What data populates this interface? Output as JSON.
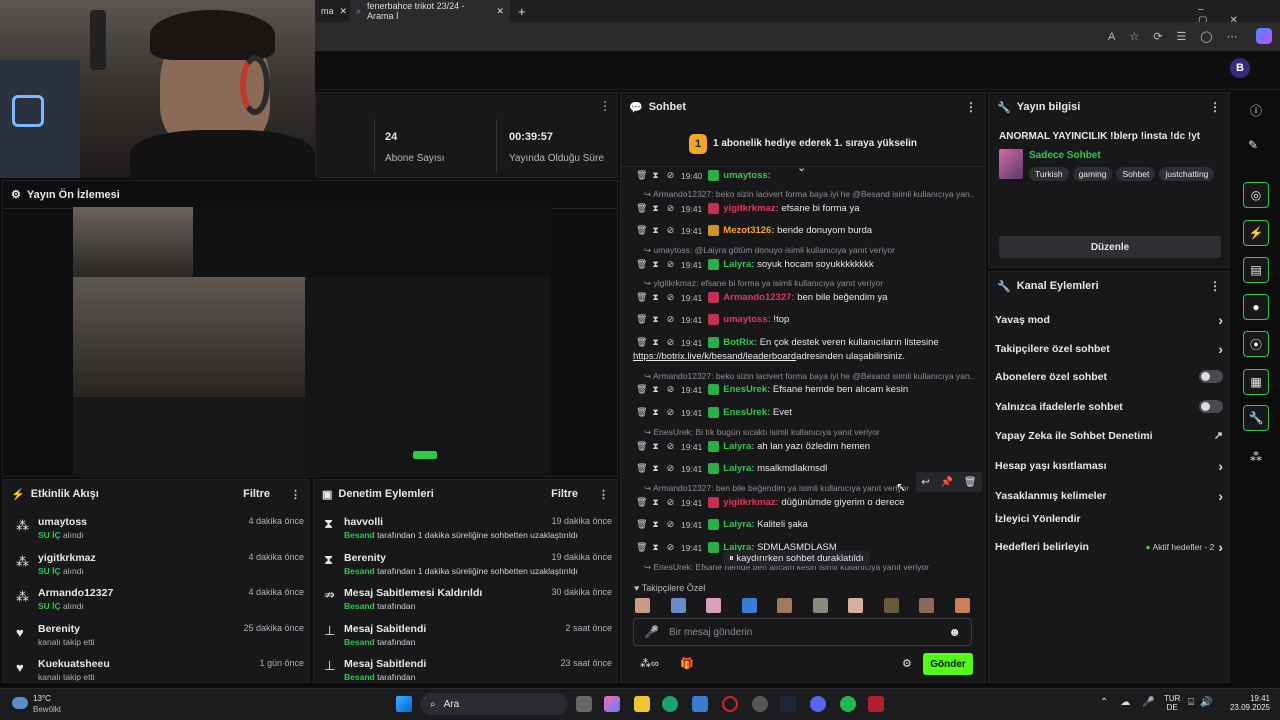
{
  "browser": {
    "tab1_label": "ma",
    "tab2_label": "fenerbahce trikot 23/24 - Arama İ",
    "new_tab": "+"
  },
  "stats": [
    {
      "value": "24",
      "label": "Abone Sayısı"
    },
    {
      "value": "00:39:57",
      "label": "Yayında Olduğu Süre"
    }
  ],
  "preview": {
    "title": "Yayın Ön İzlemesi"
  },
  "activity": {
    "title": "Etkinlik Akışı",
    "filter": "Filtre",
    "items": [
      {
        "user": "umaytoss",
        "action": "SU İÇ",
        "suffix": " alındı",
        "time": "4 dakika önce"
      },
      {
        "user": "yigitkrkmaz",
        "action": "SU İÇ",
        "suffix": " alındı",
        "time": "4 dakika önce"
      },
      {
        "user": "Armando12327",
        "action": "SU İÇ",
        "suffix": " alındı",
        "time": "4 dakika önce"
      },
      {
        "user": "Berenity",
        "action": "",
        "suffix": "kanalı takip etti",
        "time": "25 dakika önce"
      },
      {
        "user": "Kuekuatsheeu",
        "action": "",
        "suffix": "kanalı takip etti",
        "time": "1 gün önce"
      }
    ]
  },
  "moderation": {
    "title": "Denetim Eylemleri",
    "filter": "Filtre",
    "items": [
      {
        "title": "havvolli",
        "by": "Besand",
        "detail": " tarafından 1 dakika süreliğine sohbetten uzaklaştırıldı",
        "time": "19 dakika önce"
      },
      {
        "title": "Berenity",
        "by": "Besand",
        "detail": " tarafından 1 dakika süreliğine sohbetten uzaklaştırıldı",
        "time": "19 dakika önce"
      },
      {
        "title": "Mesaj Sabitlemesi Kaldırıldı",
        "by": "Besand",
        "detail": " tarafından",
        "time": "30 dakika önce"
      },
      {
        "title": "Mesaj Sabitlendi",
        "by": "Besand",
        "detail": " tarafından",
        "time": "2 saat önce"
      },
      {
        "title": "Mesaj Sabitlendi",
        "by": "Besand",
        "detail": " tarafından",
        "time": "23 saat önce"
      }
    ]
  },
  "chat": {
    "title": "Sohbet",
    "goal_badge": "1",
    "goal_text": "1 abonelik hediye ederek 1. sıraya yükselin",
    "messages": [
      {
        "kind": "msg",
        "time": "19:40",
        "user": "umaytoss:",
        "color": "#2fc94c",
        "text": ""
      },
      {
        "kind": "reply",
        "text": "Armando12327: beko sizin lacivert forma baya iyi he @Besand isimli kullanıcıya yan..."
      },
      {
        "kind": "msg",
        "time": "19:41",
        "user": "yigitkrkmaz:",
        "color": "#e0365a",
        "text": " efsane bi forma ya"
      },
      {
        "kind": "msg",
        "time": "19:41",
        "user": "Mezot3126:",
        "color": "#f5a623",
        "text": " bende donuyom burda"
      },
      {
        "kind": "reply",
        "text": "umaytoss: @Laiyra götüm donuyo isimli kullanıcıya yanıt veriyor"
      },
      {
        "kind": "msg",
        "time": "19:41",
        "user": "Laiyra:",
        "color": "#2fc94c",
        "text": " soyuk hocam soyukkkkkkkk"
      },
      {
        "kind": "reply",
        "text": "yigitkrkmaz: efsane bi forma ya isimli kullanıcıya yanıt veriyor"
      },
      {
        "kind": "msg",
        "time": "19:41",
        "user": "Armando12327:",
        "color": "#e0365a",
        "text": " ben bile beğendim ya"
      },
      {
        "kind": "msg",
        "time": "19:41",
        "user": "umaytoss:",
        "color": "#e0365a",
        "text": " !top"
      },
      {
        "kind": "msg",
        "time": "19:41",
        "user": "BotRix:",
        "color": "#2fc94c",
        "text": " En çok destek veren kullanıcıların listesine"
      },
      {
        "kind": "cont",
        "link": "https://botrix.live/k/besand/leaderboard",
        "text": " adresinden ulaşabilirsiniz."
      },
      {
        "kind": "reply",
        "text": "Armando12327: beko sizin lacivert forma baya iyi he @Besand isimli kullanıcıya yan..."
      },
      {
        "kind": "msg",
        "time": "19:41",
        "user": "EnesUrek:",
        "color": "#2fc94c",
        "text": " Efsane hemde ben alıcam kesin"
      },
      {
        "kind": "msg",
        "time": "19:41",
        "user": "EnesUrek:",
        "color": "#2fc94c",
        "text": " Evet"
      },
      {
        "kind": "reply",
        "text": "EnesUrek: Bi tık bugün sıcaktı isimli kullanıcıya yanıt veriyor"
      },
      {
        "kind": "msg",
        "time": "19:41",
        "user": "Laiyra:",
        "color": "#2fc94c",
        "text": " ah lan yazı özledim hemen"
      },
      {
        "kind": "msg",
        "time": "19:41",
        "user": "Laiyra:",
        "color": "#2fc94c",
        "text": " msalkmdlakmsdl"
      },
      {
        "kind": "reply",
        "text": "Armando12327: ben bile beğendim ya isimli kullanıcıya yanıt veriyor"
      },
      {
        "kind": "msg",
        "time": "19:41",
        "user": "yigitkrkmaz:",
        "color": "#e0365a",
        "text": " düğünümde giyerim o derece"
      },
      {
        "kind": "msg",
        "time": "19:41",
        "user": "Laiyra:",
        "color": "#2fc94c",
        "text": " Kaliteli şaka"
      },
      {
        "kind": "msg",
        "time": "19:41",
        "user": "Laiyra:",
        "color": "#2fc94c",
        "text": " SDMLASMDLASM"
      },
      {
        "kind": "reply",
        "text": "EnesUrek: Efsane hemde ben alıcam kesin isimli kullanıcıya yanıt veriyor"
      }
    ],
    "paused_text": "kaydırırken sohbet duraklatıldı",
    "followers_only": "Takipçilere Özel",
    "input_placeholder": "Bir mesaj gönderin",
    "send_label": "Gönder"
  },
  "info": {
    "title": "Yayın bilgisi",
    "stream_title": "ANORMAL YAYINCILIK !blerp !insta !dc !yt",
    "category": "Sadece Sohbet",
    "tags": [
      "Turkish",
      "gaming",
      "Sohbet",
      "justchatting"
    ],
    "edit_label": "Düzenle"
  },
  "channel_actions": {
    "title": "Kanal Eylemleri",
    "items": [
      {
        "label": "Yavaş mod",
        "ctrl": "arrow"
      },
      {
        "label": "Takipçilere özel sohbet",
        "ctrl": "arrow"
      },
      {
        "label": "Abonelere özel sohbet",
        "ctrl": "toggle"
      },
      {
        "label": "Yalnızca ifadelerle sohbet",
        "ctrl": "toggle"
      },
      {
        "label": "Yapay Zeka ile Sohbet Denetimi",
        "ctrl": "ext"
      },
      {
        "label": "Hesap yaşı kısıtlaması",
        "ctrl": "arrow"
      },
      {
        "label": "Yasaklanmış kelimeler",
        "ctrl": "arrow"
      },
      {
        "label": "İzleyici Yönlendir",
        "ctrl": "none"
      },
      {
        "label": "Hedefleri belirleyin",
        "ctrl": "arrow",
        "extra": "Aktif hedefler - 2"
      }
    ]
  },
  "taskbar": {
    "weather_temp": "13°C",
    "weather_desc": "Bewölkt",
    "search": "Ara",
    "lang1": "TUR",
    "lang2": "DE",
    "time": "19:41",
    "date": "23.09.2025"
  }
}
